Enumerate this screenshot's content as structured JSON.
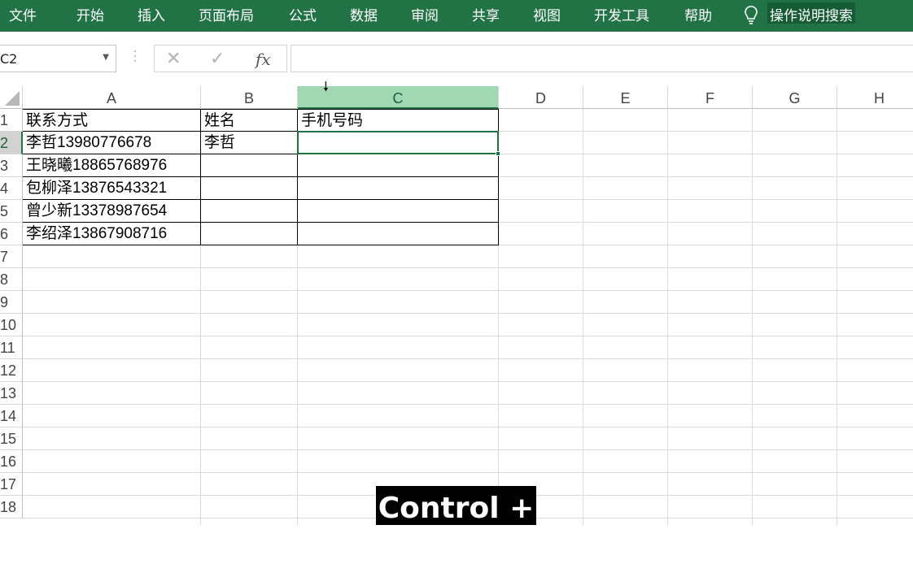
{
  "ribbon": {
    "tabs": [
      "文件",
      "开始",
      "插入",
      "页面布局",
      "公式",
      "数据",
      "审阅",
      "共享",
      "视图",
      "开发工具",
      "帮助"
    ],
    "tell_me": "操作说明搜索",
    "color": "#217346"
  },
  "formula_bar": {
    "name_box": "C2",
    "cancel_icon": "close-icon",
    "enter_icon": "check-icon",
    "fx_label": "fx",
    "value": ""
  },
  "sheet": {
    "columns": [
      "A",
      "B",
      "C",
      "D",
      "E",
      "F",
      "G",
      "H"
    ],
    "selected_column": "C",
    "rows": [
      "1",
      "2",
      "3",
      "4",
      "5",
      "6",
      "7",
      "8",
      "9",
      "10",
      "11",
      "12",
      "13",
      "14",
      "15",
      "16",
      "17",
      "18"
    ],
    "selected_row": "2",
    "active_cell": "C2",
    "data": {
      "A1": "联系方式",
      "B1": "姓名",
      "C1": "手机号码",
      "A2": "李哲13980776678",
      "B2": "李哲",
      "A3": "王晓曦18865768976",
      "A4": "包柳泽13876543321",
      "A5": "曾少新13378987654",
      "A6": "李绍泽13867908716"
    }
  },
  "keycast": "Control + c"
}
